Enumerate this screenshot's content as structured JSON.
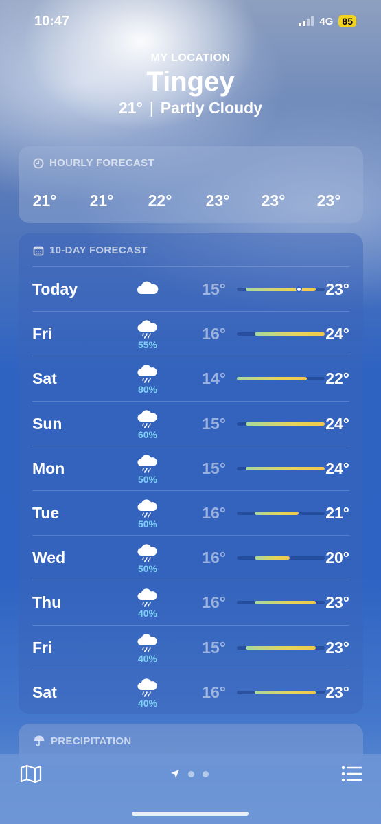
{
  "status": {
    "time": "10:47",
    "network": "4G",
    "battery": "85"
  },
  "header": {
    "location_label": "MY LOCATION",
    "city": "Tingey",
    "current_temp": "21°",
    "separator": "|",
    "condition": "Partly Cloudy"
  },
  "hourly": {
    "title": "HOURLY FORECAST",
    "icon": "clock-icon",
    "temps": [
      "21°",
      "21°",
      "22°",
      "23°",
      "23°",
      "23°"
    ]
  },
  "daily": {
    "title": "10-DAY FORECAST",
    "icon": "calendar-icon",
    "range_min": 14,
    "range_max": 24,
    "current_temp_value": 21,
    "days": [
      {
        "name": "Today",
        "icon": "cloud-icon",
        "precip": "",
        "low": "15°",
        "high": "23°",
        "low_value": 15,
        "high_value": 23
      },
      {
        "name": "Fri",
        "icon": "cloud-rain-icon",
        "precip": "55%",
        "low": "16°",
        "high": "24°",
        "low_value": 16,
        "high_value": 24
      },
      {
        "name": "Sat",
        "icon": "cloud-rain-icon",
        "precip": "80%",
        "low": "14°",
        "high": "22°",
        "low_value": 14,
        "high_value": 22
      },
      {
        "name": "Sun",
        "icon": "cloud-rain-icon",
        "precip": "60%",
        "low": "15°",
        "high": "24°",
        "low_value": 15,
        "high_value": 24
      },
      {
        "name": "Mon",
        "icon": "cloud-rain-icon",
        "precip": "50%",
        "low": "15°",
        "high": "24°",
        "low_value": 15,
        "high_value": 24
      },
      {
        "name": "Tue",
        "icon": "cloud-rain-icon",
        "precip": "50%",
        "low": "16°",
        "high": "21°",
        "low_value": 16,
        "high_value": 21
      },
      {
        "name": "Wed",
        "icon": "cloud-rain-icon",
        "precip": "50%",
        "low": "16°",
        "high": "20°",
        "low_value": 16,
        "high_value": 20
      },
      {
        "name": "Thu",
        "icon": "cloud-rain-icon",
        "precip": "40%",
        "low": "16°",
        "high": "23°",
        "low_value": 16,
        "high_value": 23
      },
      {
        "name": "Fri",
        "icon": "cloud-rain-icon",
        "precip": "40%",
        "low": "15°",
        "high": "23°",
        "low_value": 15,
        "high_value": 23
      },
      {
        "name": "Sat",
        "icon": "cloud-rain-icon",
        "precip": "40%",
        "low": "16°",
        "high": "23°",
        "low_value": 16,
        "high_value": 23
      }
    ]
  },
  "precipitation": {
    "title": "PRECIPITATION",
    "icon": "umbrella-icon"
  },
  "toolbar": {
    "map_icon": "map-icon",
    "location_icon": "location-arrow-icon",
    "list_icon": "list-icon"
  }
}
